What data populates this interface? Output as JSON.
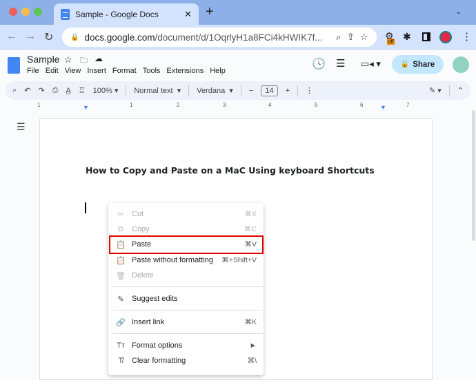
{
  "browser": {
    "tab_title": "Sample - Google Docs",
    "url_host": "docs.google.com",
    "url_path": "/document/d/1OqrlyH1a8FCi4kHWIK7f...",
    "ext_badge": "off"
  },
  "docs": {
    "title": "Sample",
    "menu": [
      "File",
      "Edit",
      "View",
      "Insert",
      "Format",
      "Tools",
      "Extensions",
      "Help"
    ],
    "share_label": "Share"
  },
  "toolbar": {
    "zoom": "100%",
    "style": "Normal text",
    "font": "Verdana",
    "font_size": "14"
  },
  "ruler": [
    "1",
    "1",
    "2",
    "3",
    "4",
    "5",
    "6",
    "7"
  ],
  "document": {
    "heading": "How to Copy and Paste on a MaC Using keyboard Shortcuts"
  },
  "context_menu": [
    {
      "label": "Cut",
      "shortcut": "⌘X",
      "icon": "✂",
      "disabled": true
    },
    {
      "label": "Copy",
      "shortcut": "⌘C",
      "icon": "⧉",
      "disabled": true
    },
    {
      "label": "Paste",
      "shortcut": "⌘V",
      "icon": "📋",
      "disabled": false
    },
    {
      "label": "Paste without formatting",
      "shortcut": "⌘+Shift+V",
      "icon": "📋",
      "disabled": false
    },
    {
      "label": "Delete",
      "shortcut": "",
      "icon": "🗑",
      "disabled": true
    },
    {
      "label": "Suggest edits",
      "shortcut": "",
      "icon": "✎",
      "disabled": false
    },
    {
      "label": "Insert link",
      "shortcut": "⌘K",
      "icon": "🔗",
      "disabled": false
    },
    {
      "label": "Format options",
      "shortcut": "►",
      "icon": "Tт",
      "disabled": false
    },
    {
      "label": "Clear formatting",
      "shortcut": "⌘\\",
      "icon": "T̸",
      "disabled": false
    }
  ]
}
